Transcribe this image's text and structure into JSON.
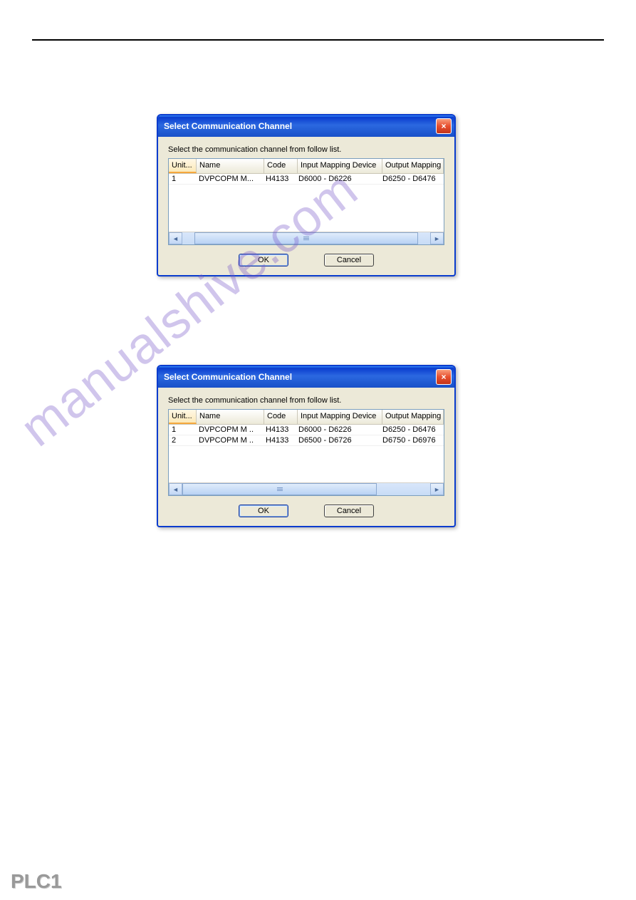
{
  "watermark_text": "manualshive.com",
  "logo_text": "PLC1",
  "dialogs": [
    {
      "title": "Select Communication Channel",
      "close_label": "×",
      "instruction": "Select the communication channel from follow list.",
      "columns": {
        "unit": "Unit...",
        "name": "Name",
        "code": "Code",
        "input": "Input Mapping Device",
        "output": "Output Mapping De"
      },
      "rows": [
        {
          "unit": "1",
          "name": "DVPCOPM M...",
          "code": "H4133",
          "input": "D6000 - D6226",
          "output": "D6250 - D6476"
        }
      ],
      "ok_label": "OK",
      "cancel_label": "Cancel",
      "scroll_left": "◄",
      "scroll_right": "►"
    },
    {
      "title": "Select Communication Channel",
      "close_label": "×",
      "instruction": "Select the communication channel from follow list.",
      "columns": {
        "unit": "Unit...",
        "name": "Name",
        "code": "Code",
        "input": "Input Mapping Device",
        "output": "Output Mapping De"
      },
      "rows": [
        {
          "unit": "1",
          "name": "DVPCOPM M ..",
          "code": "H4133",
          "input": "D6000 - D6226",
          "output": "D6250 - D6476"
        },
        {
          "unit": "2",
          "name": "DVPCOPM M ..",
          "code": "H4133",
          "input": "D6500 - D6726",
          "output": "D6750 - D6976"
        }
      ],
      "ok_label": "OK",
      "cancel_label": "Cancel",
      "scroll_left": "◄",
      "scroll_right": "►"
    }
  ]
}
